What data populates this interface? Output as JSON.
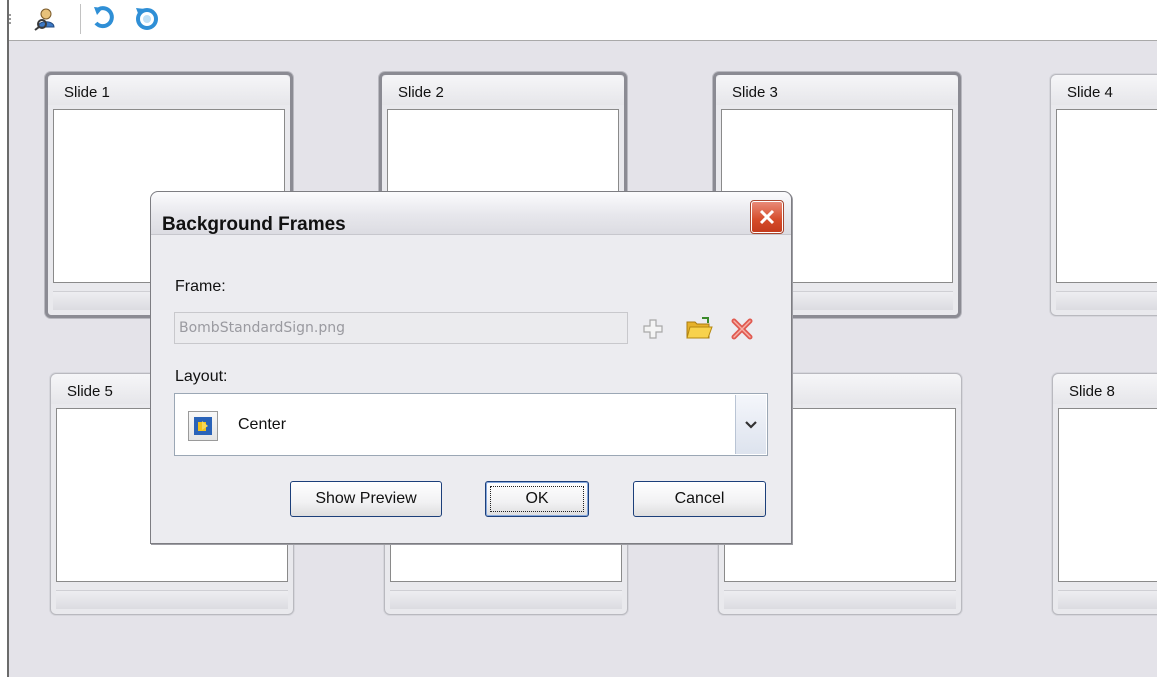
{
  "toolbar": {
    "buttons": [
      {
        "icon": "user-search-icon"
      },
      {
        "icon": "undo-icon"
      },
      {
        "icon": "redo-icon"
      }
    ]
  },
  "slides": [
    {
      "label": "Slide 1",
      "selected": true
    },
    {
      "label": "Slide 2",
      "selected": true
    },
    {
      "label": "Slide 3",
      "selected": true
    },
    {
      "label": "Slide 4",
      "selected": false
    },
    {
      "label": "Slide 5",
      "selected": false
    },
    {
      "label": "Slide 8",
      "selected": false
    }
  ],
  "dialog": {
    "title": "Background Frames",
    "frame_label": "Frame:",
    "frame_value": "BombStandardSign.png",
    "frame_icons": [
      "add-icon",
      "open-folder-icon",
      "delete-icon"
    ],
    "layout_label": "Layout:",
    "layout_value": "Center",
    "buttons": {
      "preview": "Show Preview",
      "ok": "OK",
      "cancel": "Cancel"
    }
  },
  "colors": {
    "workspace_bg": "#e4e3e9",
    "close_button": "#d54b2a",
    "button_border": "#1c3f7a"
  }
}
